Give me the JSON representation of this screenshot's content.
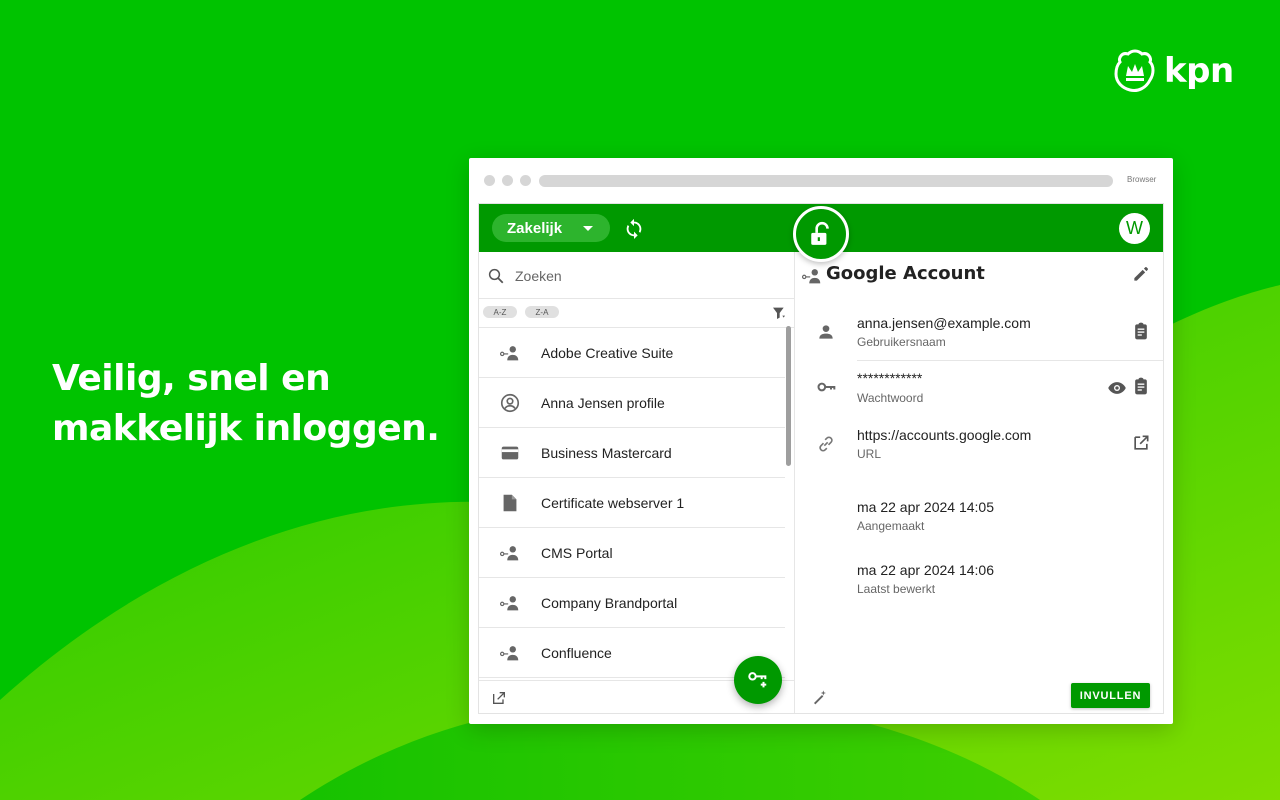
{
  "brand": {
    "name": "kpn",
    "primary_color": "#009900",
    "background_color": "#00c300",
    "accent_light": "#8ee000"
  },
  "headline": {
    "line1": "Veilig, snel en",
    "line2": "makkelijk inloggen."
  },
  "browser": {
    "label": "Browser"
  },
  "header": {
    "vault_label": "Zakelijk",
    "avatar_initial": "W",
    "lock_state": "unlocked"
  },
  "search": {
    "placeholder": "Zoeken",
    "value": ""
  },
  "sort": {
    "asc_label": "A-Z",
    "desc_label": "Z-A"
  },
  "list": {
    "items": [
      {
        "label": "Adobe Creative Suite",
        "icon": "login-icon"
      },
      {
        "label": "Anna Jensen profile",
        "icon": "profile-icon"
      },
      {
        "label": "Business Mastercard",
        "icon": "credit-card-icon"
      },
      {
        "label": "Certificate webserver 1",
        "icon": "file-icon"
      },
      {
        "label": "CMS Portal",
        "icon": "login-icon"
      },
      {
        "label": "Company Brandportal",
        "icon": "login-icon"
      },
      {
        "label": "Confluence",
        "icon": "login-icon"
      }
    ]
  },
  "detail": {
    "title": "Google Account",
    "username": {
      "value": "anna.jensen@example.com",
      "label": "Gebruikersnaam"
    },
    "password": {
      "value": "************",
      "label": "Wachtwoord"
    },
    "url": {
      "value": "https://accounts.google.com",
      "label": "URL"
    },
    "created": {
      "value": "ma 22 apr 2024 14:05",
      "label": "Aangemaakt"
    },
    "modified": {
      "value": "ma 22 apr 2024 14:06",
      "label": "Laatst bewerkt"
    },
    "fill_button": "INVULLEN"
  }
}
